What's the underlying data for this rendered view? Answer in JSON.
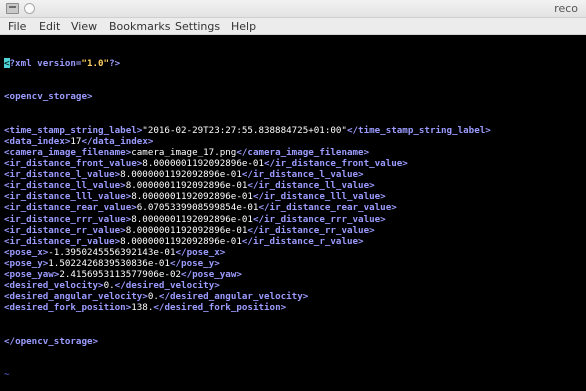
{
  "window": {
    "title": "reco"
  },
  "menu": [
    "File",
    "Edit",
    "View",
    "Bookmarks",
    "Settings",
    "Help"
  ],
  "xml": {
    "decl_rest": "?xml version=",
    "decl_version": "\"1.0\"",
    "decl_end": "?>",
    "root_open": "<opencv_storage>",
    "fields": [
      {
        "name": "time_stamp_string_label",
        "value": "\"2016-02-29T23:27:55.838884725+01:00\""
      },
      {
        "name": "data_index",
        "value": "17"
      },
      {
        "name": "camera_image_filename",
        "value": "camera_image_17.png"
      },
      {
        "name": "ir_distance_front_value",
        "value": "8.0000001192092896e-01"
      },
      {
        "name": "ir_distance_l_value",
        "value": "8.0000001192092896e-01"
      },
      {
        "name": "ir_distance_ll_value",
        "value": "8.0000001192092896e-01"
      },
      {
        "name": "ir_distance_lll_value",
        "value": "8.0000001192092896e-01"
      },
      {
        "name": "ir_distance_rear_value",
        "value": "6.0705339908599854e-01"
      },
      {
        "name": "ir_distance_rrr_value",
        "value": "8.0000001192092896e-01"
      },
      {
        "name": "ir_distance_rr_value",
        "value": "8.0000001192092896e-01"
      },
      {
        "name": "ir_distance_r_value",
        "value": "8.0000001192092896e-01"
      },
      {
        "name": "pose_x",
        "value": "-1.3950245556392143e-01"
      },
      {
        "name": "pose_y",
        "value": "1.5022426839530836e-01"
      },
      {
        "name": "pose_yaw",
        "value": "2.4156953113577906e-02"
      },
      {
        "name": "desired_velocity",
        "value": "0."
      },
      {
        "name": "desired_angular_velocity",
        "value": "0."
      },
      {
        "name": "desired_fork_position",
        "value": "138."
      }
    ],
    "root_close": "</opencv_storage>",
    "empty_line_marker": "~"
  },
  "colors": {
    "tag": "#9b9bff",
    "cursor": "#4cd4d8",
    "attribute_value": "#ffd15c",
    "background": "#000000"
  }
}
